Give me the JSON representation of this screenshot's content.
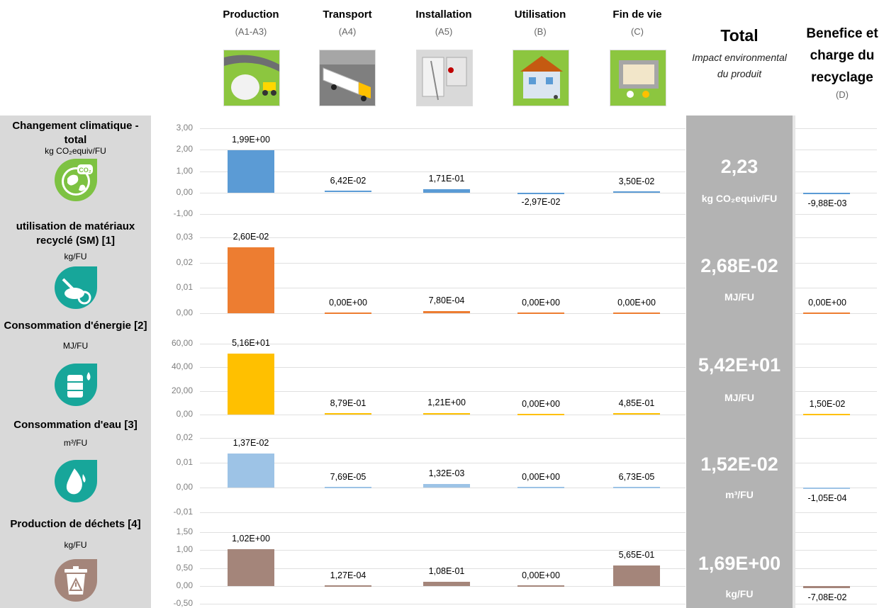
{
  "stages": [
    {
      "name": "Production",
      "code": "(A1-A3)"
    },
    {
      "name": "Transport",
      "code": "(A4)"
    },
    {
      "name": "Installation",
      "code": "(A5)"
    },
    {
      "name": "Utilisation",
      "code": "(B)"
    },
    {
      "name": "Fin de vie",
      "code": "(C)"
    }
  ],
  "total_header": {
    "title": "Total",
    "subtitle": "Impact environmental du produit"
  },
  "benefit_header": {
    "title": "Benefice et charge du recyclage",
    "code": "(D)"
  },
  "colors": {
    "left_panel": "#d9d9d9",
    "total_column": "#b3b3b3",
    "icon_teal": "#17a69a",
    "icon_green": "#7dc242",
    "icon_brown": "#a4857a"
  },
  "chart_data": [
    {
      "type": "bar",
      "indicator": "Changement climatique - total",
      "unit": "kg CO₂equiv/FU",
      "icon": "co2-globe-icon",
      "color": "#5b9bd5",
      "categories": [
        "Production",
        "Transport",
        "Installation",
        "Utilisation",
        "Fin de vie"
      ],
      "values": [
        1.99,
        0.0642,
        0.171,
        -0.0297,
        0.035
      ],
      "value_labels": [
        "1,99E+00",
        "6,42E-02",
        "1,71E-01",
        "-2,97E-02",
        "3,50E-02"
      ],
      "yticks": [
        "3,00",
        "2,00",
        "1,00",
        "0,00",
        "-1,00"
      ],
      "ylim": [
        -1,
        3
      ],
      "total": "2,23",
      "total_unit": "kg CO₂equiv/FU",
      "benefit_value": -0.00988,
      "benefit_label": "-9,88E-03"
    },
    {
      "type": "bar",
      "indicator": "utilisation de matériaux recyclé (SM) [1]",
      "unit": "kg/FU",
      "icon": "recycled-material-icon",
      "color": "#ed7d31",
      "categories": [
        "Production",
        "Transport",
        "Installation",
        "Utilisation",
        "Fin de vie"
      ],
      "values": [
        0.026,
        0,
        0.00078,
        0,
        0
      ],
      "value_labels": [
        "2,60E-02",
        "0,00E+00",
        "7,80E-04",
        "0,00E+00",
        "0,00E+00"
      ],
      "yticks": [
        "0,03",
        "0,02",
        "0,01",
        "0,00"
      ],
      "ylim": [
        0,
        0.03
      ],
      "total": "2,68E-02",
      "total_unit": "MJ/FU",
      "benefit_value": 0,
      "benefit_label": "0,00E+00"
    },
    {
      "type": "bar",
      "indicator": "Consommation d'énergie [2]",
      "unit": "MJ/FU",
      "icon": "oil-barrel-icon",
      "color": "#ffc000",
      "categories": [
        "Production",
        "Transport",
        "Installation",
        "Utilisation",
        "Fin de vie"
      ],
      "values": [
        51.6,
        0.879,
        1.21,
        0,
        0.485
      ],
      "value_labels": [
        "5,16E+01",
        "8,79E-01",
        "1,21E+00",
        "0,00E+00",
        "4,85E-01"
      ],
      "yticks": [
        "60,00",
        "40,00",
        "20,00",
        "0,00"
      ],
      "ylim": [
        0,
        60
      ],
      "total": "5,42E+01",
      "total_unit": "MJ/FU",
      "benefit_value": 0.015,
      "benefit_label": "1,50E-02"
    },
    {
      "type": "bar",
      "indicator": "Consommation d'eau [3]",
      "unit": "m³/FU",
      "icon": "water-drop-icon",
      "color": "#9dc3e6",
      "categories": [
        "Production",
        "Transport",
        "Installation",
        "Utilisation",
        "Fin de vie"
      ],
      "values": [
        0.0137,
        7.69e-05,
        0.00132,
        0,
        6.73e-05
      ],
      "value_labels": [
        "1,37E-02",
        "7,69E-05",
        "1,32E-03",
        "0,00E+00",
        "6,73E-05"
      ],
      "yticks": [
        "0,02",
        "0,01",
        "0,00",
        "-0,01"
      ],
      "ylim": [
        -0.01,
        0.02
      ],
      "total": "1,52E-02",
      "total_unit": "m³/FU",
      "benefit_value": -0.000105,
      "benefit_label": "-1,05E-04"
    },
    {
      "type": "bar",
      "indicator": "Production de déchets [4]",
      "unit": "kg/FU",
      "icon": "waste-bin-icon",
      "color": "#a4857a",
      "categories": [
        "Production",
        "Transport",
        "Installation",
        "Utilisation",
        "Fin de vie"
      ],
      "values": [
        1.02,
        0.000127,
        0.108,
        0,
        0.565
      ],
      "value_labels": [
        "1,02E+00",
        "1,27E-04",
        "1,08E-01",
        "0,00E+00",
        "5,65E-01"
      ],
      "yticks": [
        "1,50",
        "1,00",
        "0,50",
        "0,00",
        "-0,50"
      ],
      "ylim": [
        -0.5,
        1.5
      ],
      "total": "1,69E+00",
      "total_unit": "kg/FU",
      "benefit_value": -0.0708,
      "benefit_label": "-7,08E-02"
    }
  ]
}
